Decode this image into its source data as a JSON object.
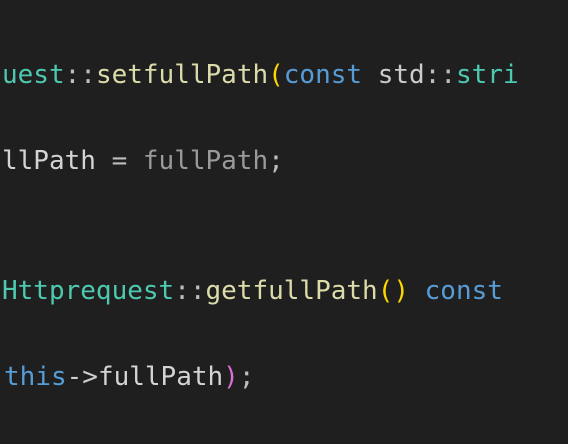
{
  "theme": {
    "background": "#1f1f1f",
    "colors": {
      "class": "#4ec9b0",
      "function": "#dcdcaa",
      "keyword": "#569cd6",
      "bracket_level1": "#ffd700",
      "bracket_level2": "#da70d6",
      "parameter": "#9a9a9a",
      "text": "#d4d4d4"
    }
  },
  "code": {
    "line1": {
      "t1": "uest",
      "t2": "::",
      "t3": "setfullPath",
      "t4": "(",
      "t5": "const",
      "t6": " ",
      "t7": "std",
      "t8": "::",
      "t9": "stri"
    },
    "line2": {
      "t1": "llPath",
      "t2": " = ",
      "t3": "fullPath",
      "t4": ";"
    },
    "line3": {
      "t1": "Httprequest",
      "t2": "::",
      "t3": "getfullPath",
      "t4": "()",
      "t5": " ",
      "t6": "const"
    },
    "line4": {
      "t1": "this",
      "t2": "->",
      "t3": "fullPath",
      "t4": ")",
      "t5": ";"
    }
  }
}
